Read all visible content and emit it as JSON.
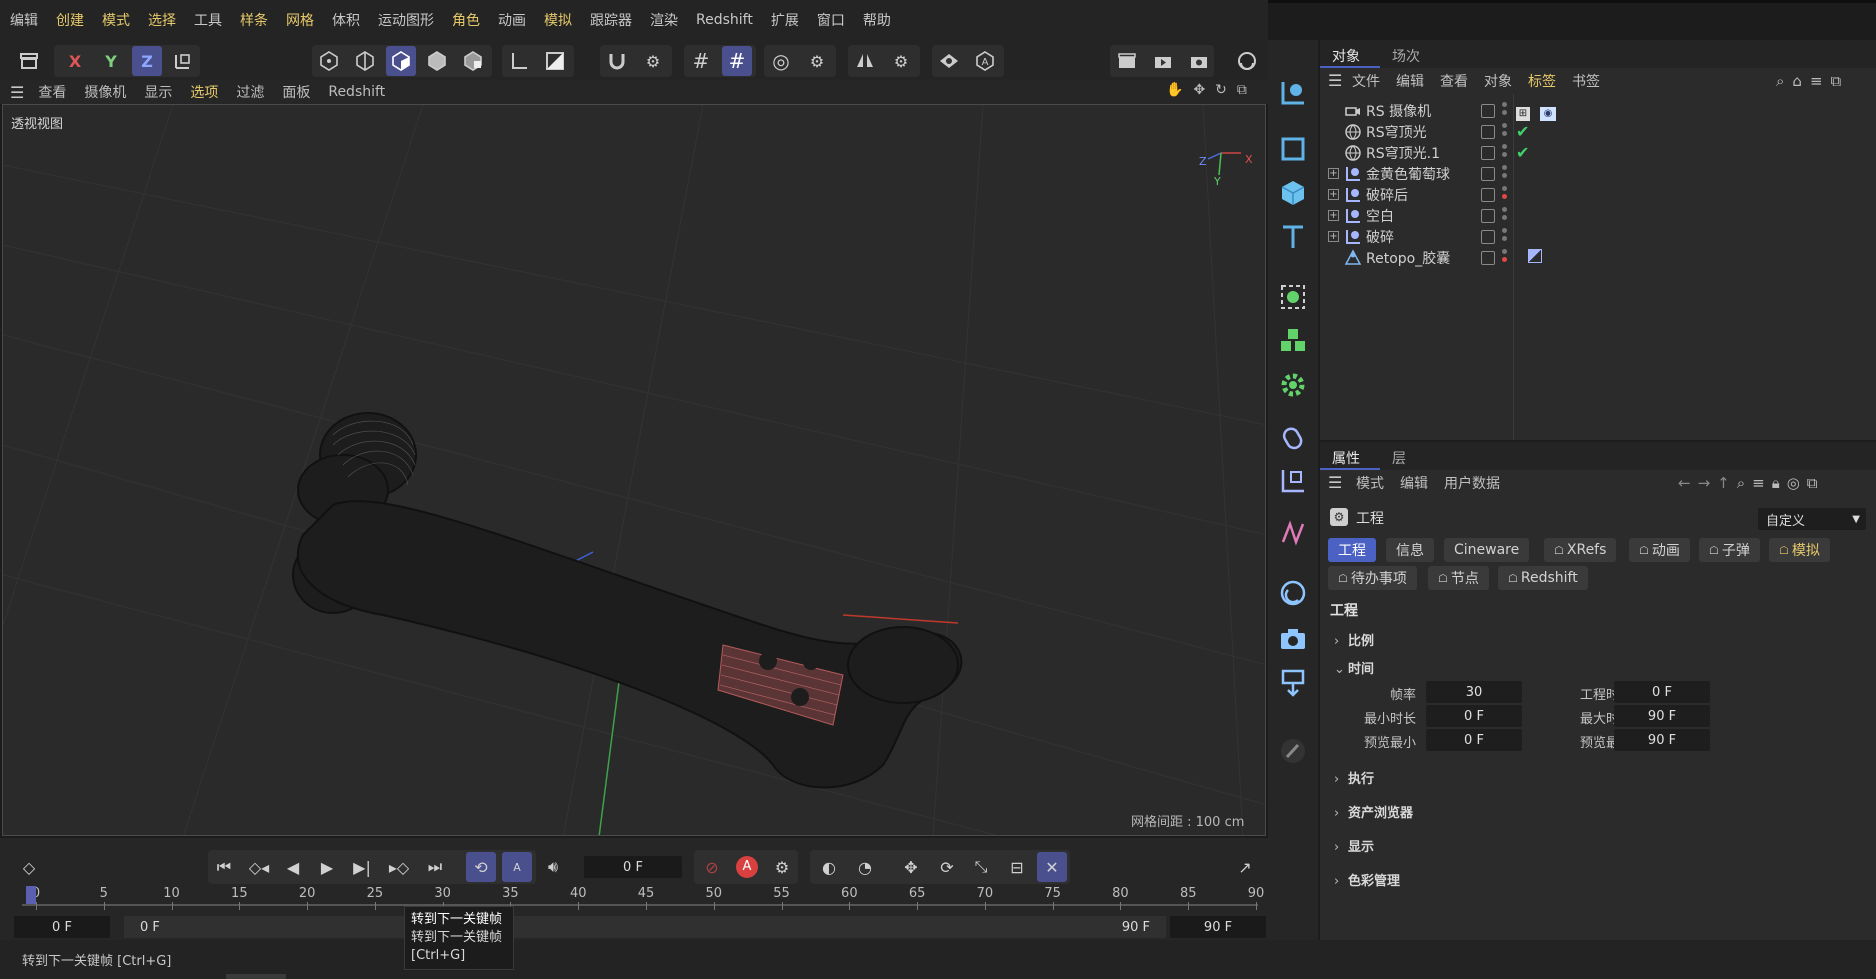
{
  "menubar": {
    "items": [
      {
        "label": "编辑",
        "hl": false
      },
      {
        "label": "创建",
        "hl": true
      },
      {
        "label": "模式",
        "hl": true
      },
      {
        "label": "选择",
        "hl": true
      },
      {
        "label": "工具",
        "hl": false
      },
      {
        "label": "样条",
        "hl": true
      },
      {
        "label": "网格",
        "hl": true
      },
      {
        "label": "体积",
        "hl": false
      },
      {
        "label": "运动图形",
        "hl": false
      },
      {
        "label": "角色",
        "hl": true
      },
      {
        "label": "动画",
        "hl": false
      },
      {
        "label": "模拟",
        "hl": true
      },
      {
        "label": "跟踪器",
        "hl": false
      },
      {
        "label": "渲染",
        "hl": false
      },
      {
        "label": "Redshift",
        "hl": false
      },
      {
        "label": "扩展",
        "hl": false
      },
      {
        "label": "窗口",
        "hl": false
      },
      {
        "label": "帮助",
        "hl": false
      }
    ]
  },
  "toolbar": {
    "axis_x": "X",
    "axis_y": "Y",
    "axis_z": "Z"
  },
  "viewport_menu": {
    "items": [
      {
        "label": "查看",
        "hl": false
      },
      {
        "label": "摄像机",
        "hl": false
      },
      {
        "label": "显示",
        "hl": false
      },
      {
        "label": "选项",
        "hl": true
      },
      {
        "label": "过滤",
        "hl": false
      },
      {
        "label": "面板",
        "hl": false
      },
      {
        "label": "Redshift",
        "hl": false
      }
    ]
  },
  "viewport": {
    "title": "透视视图",
    "grid_spacing": "网格间距 : 100 cm",
    "gizmo": {
      "x": "X",
      "y": "Y",
      "z": "Z"
    }
  },
  "object_manager": {
    "tabs": [
      "对象",
      "场次"
    ],
    "menu": [
      {
        "label": "文件",
        "hl": false
      },
      {
        "label": "编辑",
        "hl": false
      },
      {
        "label": "查看",
        "hl": false
      },
      {
        "label": "对象",
        "hl": false
      },
      {
        "label": "标签",
        "hl": true
      },
      {
        "label": "书签",
        "hl": false
      }
    ],
    "objects": [
      {
        "name": "RS 摄像机",
        "expand": false,
        "icon": "camera-object-icon",
        "dots": [
          "grey",
          "grey"
        ],
        "tag": "camera-tag"
      },
      {
        "name": "RS穹顶光",
        "expand": false,
        "icon": "dome-light-icon",
        "dots": [
          "grey",
          "grey"
        ],
        "tag": "check"
      },
      {
        "name": "RS穹顶光.1",
        "expand": false,
        "icon": "dome-light-icon",
        "dots": [
          "grey",
          "grey"
        ],
        "tag": "check"
      },
      {
        "name": "金黄色葡萄球",
        "expand": true,
        "icon": "null-object-icon",
        "dots": [
          "grey",
          "grey"
        ],
        "tag": ""
      },
      {
        "name": "破碎后",
        "expand": true,
        "icon": "null-object-icon",
        "dots": [
          "grey",
          "red"
        ],
        "tag": ""
      },
      {
        "name": "空白",
        "expand": true,
        "icon": "null-object-icon",
        "dots": [
          "grey",
          "grey"
        ],
        "tag": ""
      },
      {
        "name": "破碎",
        "expand": true,
        "icon": "null-object-icon",
        "dots": [
          "grey",
          "grey"
        ],
        "tag": ""
      },
      {
        "name": "Retopo_胶囊",
        "expand": false,
        "icon": "polygon-object-icon",
        "dots": [
          "grey",
          "red"
        ],
        "tag": "material-tag"
      }
    ]
  },
  "attributes": {
    "tabs": [
      "属性",
      "层"
    ],
    "menu": [
      "模式",
      "编辑",
      "用户数据"
    ],
    "object_title": "工程",
    "preset": "自定义",
    "pills_row1": [
      {
        "label": "工程",
        "on": true,
        "gold": false
      },
      {
        "label": "信息",
        "on": false,
        "gold": false
      },
      {
        "label": "Cineware",
        "on": false,
        "gold": false
      },
      {
        "label": "XRefs",
        "on": false,
        "gold": false
      },
      {
        "label": "动画",
        "on": false,
        "gold": false
      },
      {
        "label": "子弹",
        "on": false,
        "gold": false
      },
      {
        "label": "模拟",
        "on": false,
        "gold": true
      }
    ],
    "pills_row2": [
      {
        "label": "待办事项"
      },
      {
        "label": "节点"
      },
      {
        "label": "Redshift"
      }
    ],
    "section_heading": "工程",
    "sections": {
      "scale": "比例",
      "time": "时间",
      "execute": "执行",
      "asset_browser": "资产浏览器",
      "display": "显示",
      "color_mgmt": "色彩管理"
    },
    "fields": {
      "fps_label": "帧率",
      "fps_value": "30",
      "proj_len_label": "工程时长",
      "proj_len_value": "0 F",
      "min_label": "最小时长",
      "min_value": "0 F",
      "max_label": "最大时长",
      "max_value": "90 F",
      "pmin_label": "预览最小",
      "pmin_value": "0 F",
      "pmax_label": "预览最大",
      "pmax_value": "90 F"
    }
  },
  "timeline": {
    "current_frame": "0 F",
    "ticks": [
      "0",
      "5",
      "10",
      "15",
      "20",
      "25",
      "30",
      "35",
      "40",
      "45",
      "50",
      "55",
      "60",
      "65",
      "70",
      "75",
      "80",
      "85",
      "90"
    ],
    "range_start": "0 F",
    "range_start2": "0 F",
    "range_end": "90 F",
    "range_end2": "90 F"
  },
  "tooltip": {
    "line1": "转到下一关键帧",
    "line2": "转到下一关键帧",
    "line3": "[Ctrl+G]"
  },
  "status": {
    "text": "转到下一关键帧 [Ctrl+G]"
  }
}
